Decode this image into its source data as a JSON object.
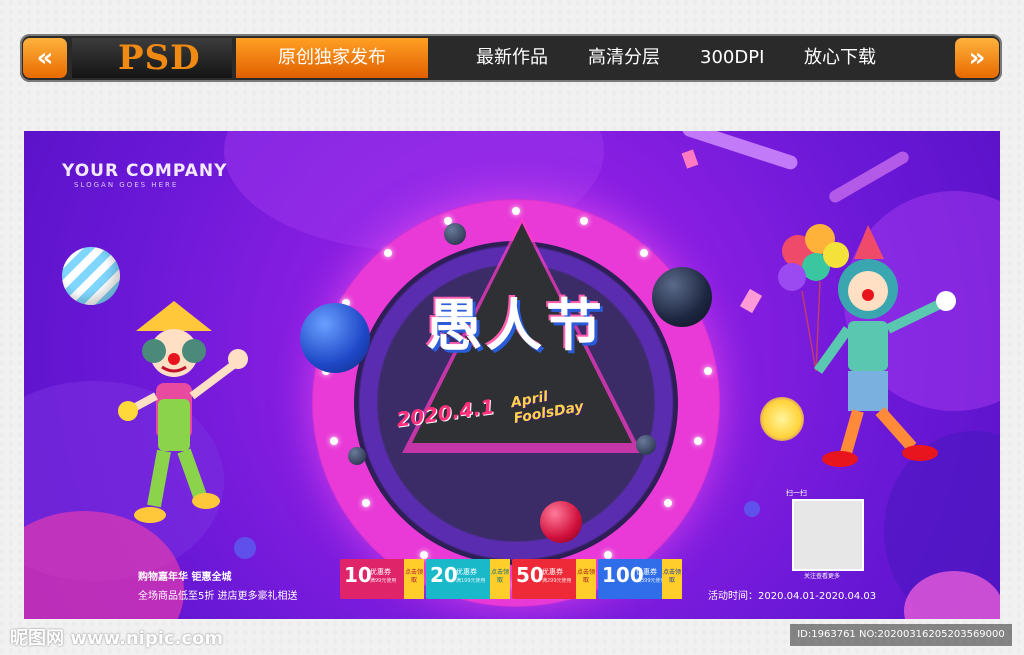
{
  "topbar": {
    "prev_icon": "«",
    "next_icon": "»",
    "logo": "PSD",
    "original_tab": "原创独家发布",
    "features": [
      "最新作品",
      "高清分层",
      "300DPI",
      "放心下载"
    ]
  },
  "banner": {
    "company": "YOUR COMPANY",
    "slogan": "SLOGAN GOES HERE",
    "title": "愚人节",
    "date": "2020.4.1",
    "april_line1": "April",
    "april_line2": "FoolsDay",
    "promo_line1": "购物嘉年华 钜惠全城",
    "promo_line2": "全场商品低至5折 进店更多豪礼相送",
    "coupons": [
      {
        "amount": "10",
        "label": "优惠券",
        "sub": "满99元使用",
        "action": "点击领取",
        "color": "#e0246a",
        "btn": "#ffce2a"
      },
      {
        "amount": "20",
        "label": "优惠券",
        "sub": "满199元使用",
        "action": "点击领取",
        "color": "#19b9c9",
        "btn": "#ffce2a"
      },
      {
        "amount": "50",
        "label": "优惠券",
        "sub": "满299元使用",
        "action": "点击领取",
        "color": "#ee2a39",
        "btn": "#ffce2a"
      },
      {
        "amount": "100",
        "label": "优惠券",
        "sub": "满399元使用",
        "action": "点击领取",
        "color": "#2f6ee8",
        "btn": "#ffce2a"
      }
    ],
    "qr_label": "扫一扫",
    "qr_caption": "关注查看更多",
    "event_time": "活动时间：2020.04.01-2020.04.03"
  },
  "watermark": {
    "site": "昵图网 www.nipic.com",
    "id": "ID:1963761 NO:20200316205203569000"
  }
}
